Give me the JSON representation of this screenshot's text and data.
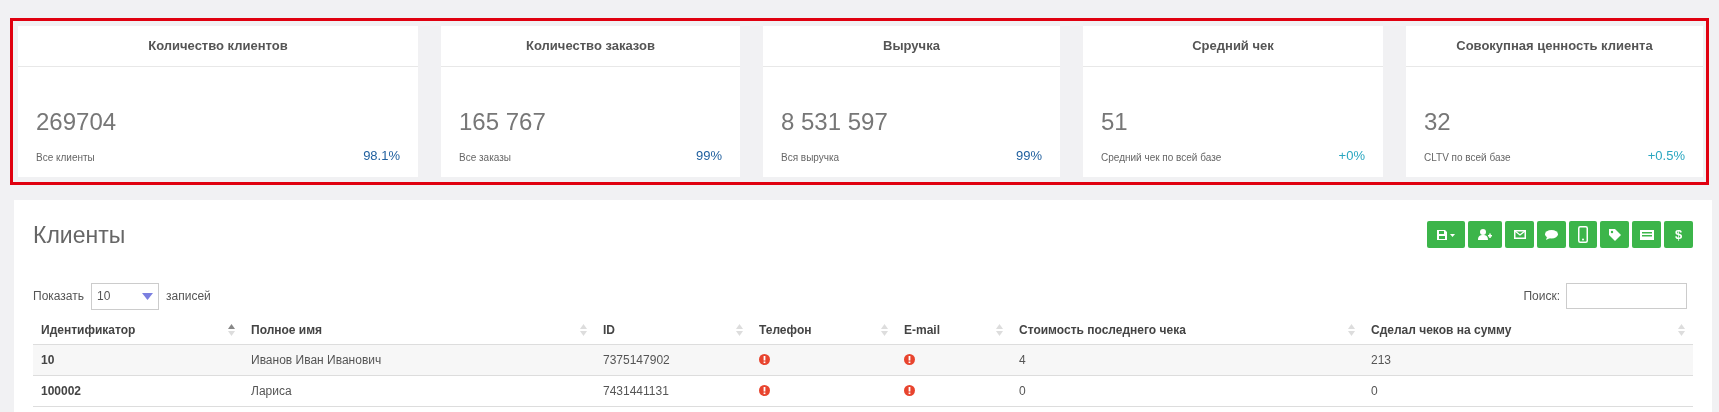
{
  "stats": {
    "highlighted": true,
    "cards": [
      {
        "title": "Количество клиентов",
        "value": "269704",
        "caption": "Все клиенты",
        "change": "98.1%",
        "color": "#1f5f9e"
      },
      {
        "title": "Количество заказов",
        "value": "165 767",
        "caption": "Все заказы",
        "change": "99%",
        "color": "#1f5f9e"
      },
      {
        "title": "Выручка",
        "value": "8 531 597",
        "caption": "Вся выручка",
        "change": "99%",
        "color": "#1f5f9e"
      },
      {
        "title": "Средний чек",
        "value": "51",
        "caption": "Средний чек по всей базе",
        "change": "+0%",
        "color": "#2aa7c0"
      },
      {
        "title": "Совокупная ценность клиента",
        "value": "32",
        "caption": "CLTV по всей базе",
        "change": "+0.5%",
        "color": "#2aa7c0"
      }
    ]
  },
  "clients": {
    "title": "Клиенты",
    "toolbar": [
      {
        "kind": "save"
      },
      {
        "kind": "user-add"
      },
      {
        "kind": "mail"
      },
      {
        "kind": "chat"
      },
      {
        "kind": "phone"
      },
      {
        "kind": "tag"
      },
      {
        "kind": "card"
      },
      {
        "kind": "text",
        "label": "$"
      }
    ],
    "length": {
      "prefix": "Показать",
      "value": "10",
      "suffix": "записей"
    },
    "search": {
      "label": "Поиск:"
    },
    "columns": [
      {
        "label": "Идентификатор",
        "sorted": true
      },
      {
        "label": "Полное имя",
        "sorted": false
      },
      {
        "label": "ID",
        "sorted": false
      },
      {
        "label": "Телефон",
        "sorted": false
      },
      {
        "label": "E-mail",
        "sorted": false
      },
      {
        "label": "Стоимость последнего чека",
        "sorted": false
      },
      {
        "label": "Сделал чеков на сумму",
        "sorted": false
      }
    ],
    "rows": [
      {
        "id": "10",
        "name": "Иванов Иван Иванович",
        "ext_id": "7375147902",
        "phone_missing": true,
        "email_missing": true,
        "last_check": "4",
        "total": "213"
      },
      {
        "id": "100002",
        "name": "Лариса",
        "ext_id": "7431441131",
        "phone_missing": true,
        "email_missing": true,
        "last_check": "0",
        "total": "0"
      }
    ]
  }
}
